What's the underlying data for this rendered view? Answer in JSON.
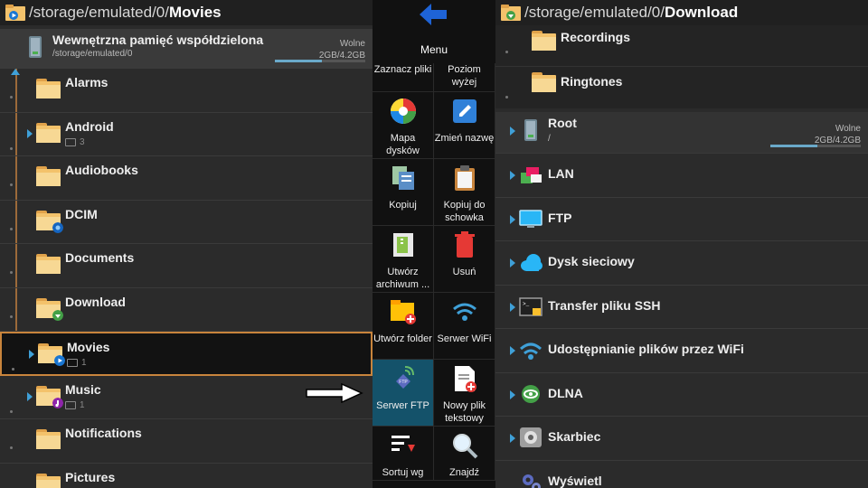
{
  "left": {
    "path_prefix": "/storage/emulated/0/",
    "path_current": "Movies",
    "storage": {
      "title": "Wewnętrzna pamięć współdzielona",
      "path": "/storage/emulated/0",
      "free_label": "Wolne",
      "free_value": "2GB/4.2GB",
      "used_fraction": 0.52
    },
    "items": [
      {
        "name": "Alarms",
        "count": ""
      },
      {
        "name": "Android",
        "count": "3"
      },
      {
        "name": "Audiobooks",
        "count": ""
      },
      {
        "name": "DCIM",
        "count": ""
      },
      {
        "name": "Documents",
        "count": ""
      },
      {
        "name": "Download",
        "count": ""
      },
      {
        "name": "Movies",
        "count": "1"
      },
      {
        "name": "Music",
        "count": "1"
      },
      {
        "name": "Notifications",
        "count": ""
      },
      {
        "name": "Pictures",
        "count": ""
      }
    ]
  },
  "menu": {
    "title": "Menu",
    "items": [
      {
        "label": "Zaznacz pliki",
        "icon": "select-files-icon"
      },
      {
        "label": "Poziom wyżej",
        "icon": "level-up-icon"
      },
      {
        "label": "Mapa dysków",
        "icon": "disk-map-icon"
      },
      {
        "label": "Zmień nazwę",
        "icon": "rename-icon"
      },
      {
        "label": "Kopiuj",
        "icon": "copy-icon"
      },
      {
        "label": "Kopiuj do schowka",
        "icon": "clipboard-icon"
      },
      {
        "label": "Utwórz archiwum ...",
        "icon": "archive-icon"
      },
      {
        "label": "Usuń",
        "icon": "trash-icon"
      },
      {
        "label": "Utwórz folder",
        "icon": "new-folder-icon"
      },
      {
        "label": "Serwer WiFi",
        "icon": "wifi-icon"
      },
      {
        "label": "Serwer FTP",
        "icon": "ftp-server-icon"
      },
      {
        "label": "Nowy plik tekstowy",
        "icon": "new-text-file-icon"
      },
      {
        "label": "Sortuj wg",
        "icon": "sort-icon"
      },
      {
        "label": "Znajdź",
        "icon": "search-icon"
      }
    ]
  },
  "right": {
    "path_prefix": "/storage/emulated/0/",
    "path_current": "Download",
    "folders": [
      {
        "name": "Recordings"
      },
      {
        "name": "Ringtones"
      }
    ],
    "root": {
      "name": "Root",
      "path": "/",
      "free_label": "Wolne",
      "free_value": "2GB/4.2GB",
      "used_fraction": 0.52
    },
    "locations": [
      {
        "name": "LAN",
        "icon": "lan-icon"
      },
      {
        "name": "FTP",
        "icon": "ftp-monitor-icon"
      },
      {
        "name": "Dysk sieciowy",
        "icon": "cloud-icon"
      },
      {
        "name": "Transfer pliku SSH",
        "icon": "ssh-terminal-icon"
      },
      {
        "name": "Udostępnianie plików przez WiFi",
        "icon": "wifi-share-icon"
      },
      {
        "name": "DLNA",
        "icon": "dlna-icon"
      },
      {
        "name": "Skarbiec",
        "icon": "vault-icon"
      },
      {
        "name": "Wyświetl",
        "icon": "settings-gears-icon"
      }
    ]
  },
  "colors": {
    "accent_blue": "#3fa0d8",
    "selection_border": "#c8843c",
    "highlight_cell": "#14526a",
    "folder_yellow": "#f3c26b"
  }
}
